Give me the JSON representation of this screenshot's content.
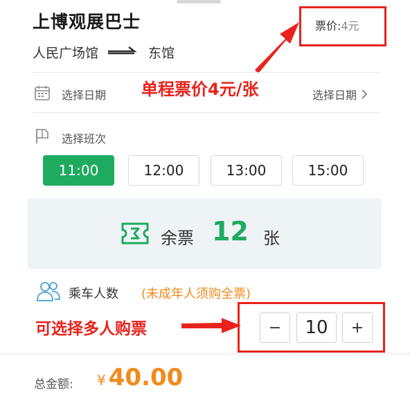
{
  "header": {
    "title": "上博观展巴士",
    "route_from": "人民广场馆",
    "route_to": "东馆",
    "price_label": "票价:",
    "price_value": "4元"
  },
  "annotations": {
    "single_price": "单程票价4元/张",
    "multi_purchase": "可选择多人购票",
    "highlight_color": "#e8221b"
  },
  "date": {
    "label": "选择日期",
    "select_label": "选择日期"
  },
  "shift": {
    "label": "选择班次",
    "times": [
      "11:00",
      "12:00",
      "13:00",
      "15:00"
    ],
    "selected": "11:00"
  },
  "remaining": {
    "label": "余票",
    "count": "12",
    "unit": "张"
  },
  "passengers": {
    "label": "乘车人数",
    "note": "(未成年人须购全票)",
    "minus": "−",
    "plus": "+",
    "value": "10"
  },
  "footer": {
    "total_label": "总金额:",
    "currency": "¥",
    "total_amount": "40.00"
  },
  "colors": {
    "accent_green": "#1eab5f",
    "accent_orange": "#f28a1b",
    "annotation_red": "#e8221b"
  }
}
